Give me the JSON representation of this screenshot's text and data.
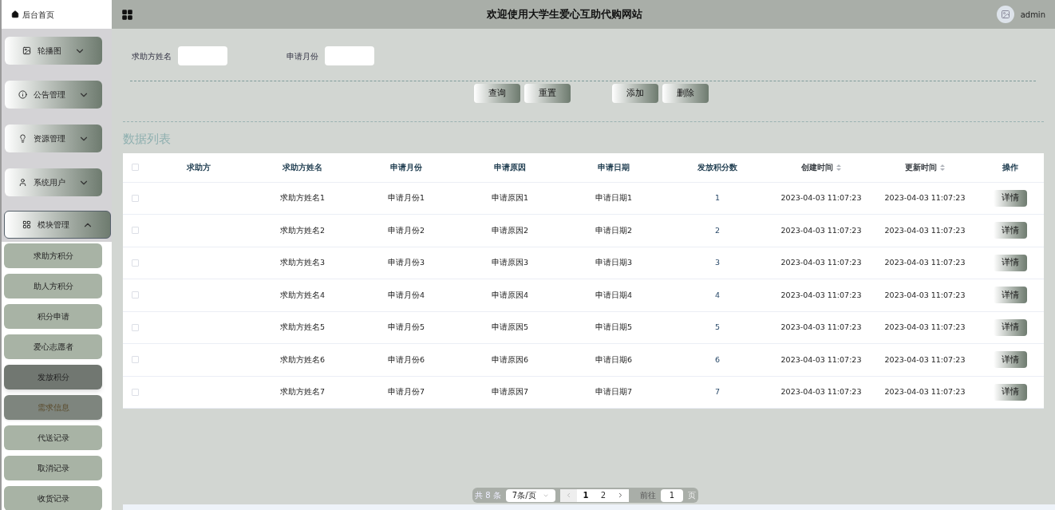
{
  "sidebar": {
    "home": "后台首页",
    "groups": [
      {
        "label": "轮播图",
        "expanded": false
      },
      {
        "label": "公告管理",
        "expanded": false
      },
      {
        "label": "资源管理",
        "expanded": false
      },
      {
        "label": "系统用户",
        "expanded": false
      },
      {
        "label": "模块管理",
        "expanded": true,
        "children": [
          {
            "label": "求助方积分",
            "selected": false,
            "hovered": false
          },
          {
            "label": "助人方积分",
            "selected": false,
            "hovered": false
          },
          {
            "label": "积分申请",
            "selected": false,
            "hovered": false
          },
          {
            "label": "爱心志愿者",
            "selected": false,
            "hovered": false
          },
          {
            "label": "发放积分",
            "selected": true,
            "hovered": false
          },
          {
            "label": "需求信息",
            "selected": false,
            "hovered": true
          },
          {
            "label": "代送记录",
            "selected": false,
            "hovered": false
          },
          {
            "label": "取消记录",
            "selected": false,
            "hovered": false
          },
          {
            "label": "收货记录",
            "selected": false,
            "hovered": false
          }
        ]
      }
    ]
  },
  "header": {
    "title": "欢迎使用大学生爱心互助代购网站",
    "user": "admin"
  },
  "filters": [
    {
      "label": "求助方姓名"
    },
    {
      "label": "申请月份"
    }
  ],
  "actions": [
    {
      "label": "查询"
    },
    {
      "label": "重置"
    },
    {
      "label": "添加"
    },
    {
      "label": "删除"
    }
  ],
  "section_title": "数据列表",
  "table": {
    "select_all_checked": false,
    "columns": [
      {
        "label": "求助方",
        "sortable": false
      },
      {
        "label": "求助方姓名",
        "sortable": false
      },
      {
        "label": "申请月份",
        "sortable": false
      },
      {
        "label": "申请原因",
        "sortable": false
      },
      {
        "label": "申请日期",
        "sortable": false
      },
      {
        "label": "发放积分数",
        "sortable": false
      },
      {
        "label": "创建时间",
        "sortable": true
      },
      {
        "label": "更新时间",
        "sortable": true
      },
      {
        "label": "操作",
        "sortable": false
      }
    ],
    "rows": [
      {
        "checked": false,
        "cells": [
          "",
          "求助方姓名1",
          "申请月份1",
          "申请原因1",
          "申请日期1",
          "1",
          "2023-04-03 11:07:23",
          "2023-04-03 11:07:23"
        ],
        "action": "详情"
      },
      {
        "checked": false,
        "cells": [
          "",
          "求助方姓名2",
          "申请月份2",
          "申请原因2",
          "申请日期2",
          "2",
          "2023-04-03 11:07:23",
          "2023-04-03 11:07:23"
        ],
        "action": "详情"
      },
      {
        "checked": false,
        "cells": [
          "",
          "求助方姓名3",
          "申请月份3",
          "申请原因3",
          "申请日期3",
          "3",
          "2023-04-03 11:07:23",
          "2023-04-03 11:07:23"
        ],
        "action": "详情"
      },
      {
        "checked": false,
        "cells": [
          "",
          "求助方姓名4",
          "申请月份4",
          "申请原因4",
          "申请日期4",
          "4",
          "2023-04-03 11:07:23",
          "2023-04-03 11:07:23"
        ],
        "action": "详情"
      },
      {
        "checked": false,
        "cells": [
          "",
          "求助方姓名5",
          "申请月份5",
          "申请原因5",
          "申请日期5",
          "5",
          "2023-04-03 11:07:23",
          "2023-04-03 11:07:23"
        ],
        "action": "详情"
      },
      {
        "checked": false,
        "cells": [
          "",
          "求助方姓名6",
          "申请月份6",
          "申请原因6",
          "申请日期6",
          "6",
          "2023-04-03 11:07:23",
          "2023-04-03 11:07:23"
        ],
        "action": "详情"
      },
      {
        "checked": false,
        "cells": [
          "",
          "求助方姓名7",
          "申请月份7",
          "申请原因7",
          "申请日期7",
          "7",
          "2023-04-03 11:07:23",
          "2023-04-03 11:07:23"
        ],
        "action": "详情"
      }
    ]
  },
  "pagination": {
    "total": "共 8 条",
    "page_size": "7条/页",
    "pages": [
      {
        "label": "1",
        "selected": true
      },
      {
        "label": "2",
        "selected": false
      }
    ],
    "goto_label": "前往",
    "goto_value": "1",
    "goto_suffix": "页"
  }
}
